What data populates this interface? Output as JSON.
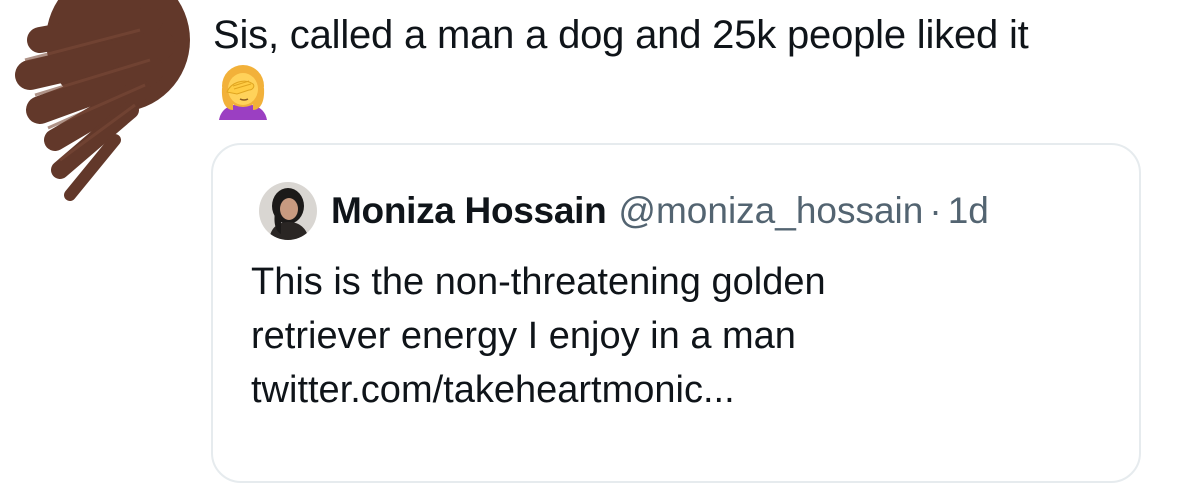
{
  "tweet": {
    "text": "Sis, called a man a dog and 25k people liked it",
    "emoji": "facepalm-woman-emoji"
  },
  "quoted_tweet": {
    "display_name": "Moniza Hossain",
    "handle": "@moniza_hossain",
    "separator": "·",
    "time": "1d",
    "body_lines": [
      "This is the non-threatening golden",
      "retriever energy I enjoy in a man",
      "twitter.com/takeheartmonic..."
    ]
  },
  "colors": {
    "text": "#0f1419",
    "secondary": "#536471",
    "border": "#e6ebee",
    "scribble": "#5a2e1f"
  }
}
